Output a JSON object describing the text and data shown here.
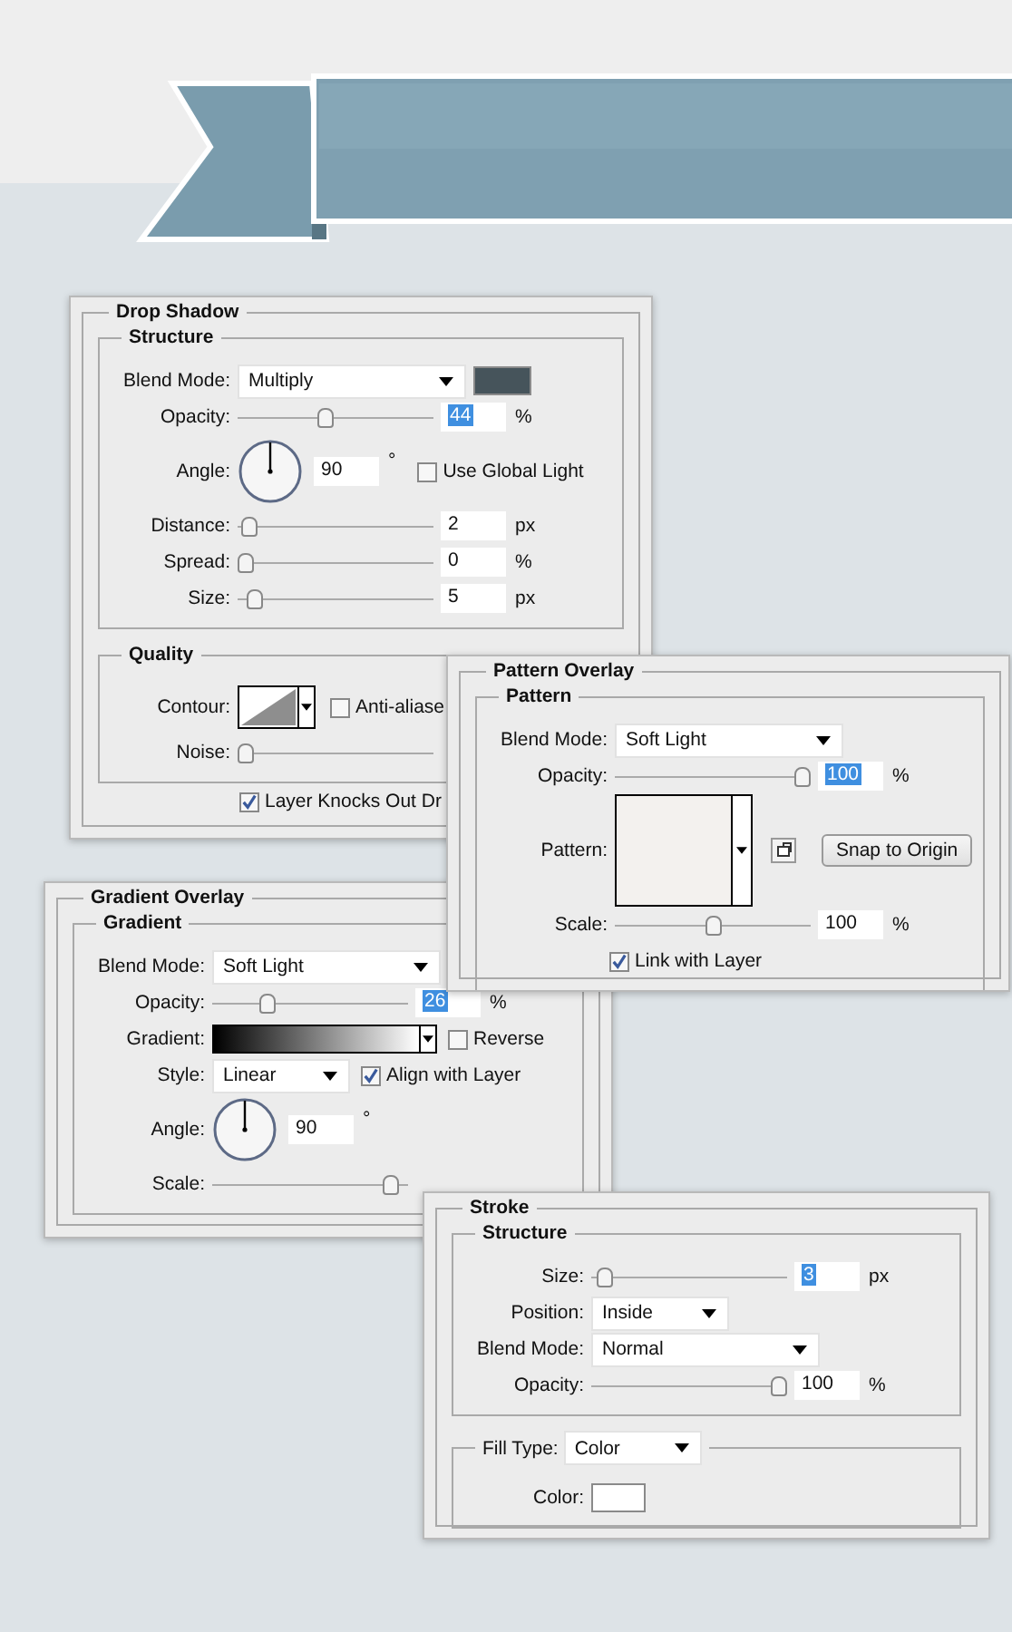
{
  "panels": [
    {
      "kind": "drop_shadow",
      "title": "Drop Shadow",
      "sections": [
        {
          "title": "Structure",
          "rows": [
            {
              "kind": "select",
              "label": "Blend Mode:",
              "value": "Multiply",
              "color": "#46545b"
            },
            {
              "kind": "slider",
              "label": "Opacity:",
              "level": 0.44,
              "value": "44",
              "unit": "%",
              "selected": true
            },
            {
              "kind": "angle",
              "label": "Angle:",
              "value": "90",
              "unit": "°",
              "checkbox": {
                "label": "Use Global Light",
                "checked": false
              }
            },
            {
              "kind": "slider",
              "label": "Distance:",
              "level": 0.02,
              "value": "2",
              "unit": "px",
              "selected": false
            },
            {
              "kind": "slider",
              "label": "Spread:",
              "level": 0,
              "value": "0",
              "unit": "%",
              "selected": false
            },
            {
              "kind": "slider",
              "label": "Size:",
              "level": 0.05,
              "value": "5",
              "unit": "px",
              "selected": false
            }
          ]
        },
        {
          "title": "Quality",
          "rows": [
            {
              "kind": "contour",
              "label": "Contour:",
              "checkbox": {
                "label": "Anti-aliase",
                "checked": false
              }
            },
            {
              "kind": "slider",
              "label": "Noise:",
              "level": 0
            }
          ]
        }
      ],
      "footer": {
        "label": "Layer Knocks Out Dr",
        "checked": true
      }
    },
    {
      "kind": "gradient_overlay",
      "title": "Gradient Overlay",
      "sections": [
        {
          "title": "Gradient",
          "rows": [
            {
              "kind": "select",
              "label": "Blend Mode:",
              "value": "Soft Light"
            },
            {
              "kind": "slider",
              "label": "Opacity:",
              "level": 0.26,
              "value": "26",
              "unit": "%",
              "selected": true
            },
            {
              "kind": "gradient",
              "label": "Gradient:",
              "checkbox": {
                "label": "Reverse",
                "checked": false
              }
            },
            {
              "kind": "short_select",
              "label": "Style:",
              "value": "Linear",
              "checkbox": {
                "label": "Align with Layer",
                "checked": true
              }
            },
            {
              "kind": "angle",
              "label": "Angle:",
              "value": "90",
              "unit": "°"
            },
            {
              "kind": "slider",
              "label": "Scale:",
              "level": 0.95
            }
          ]
        }
      ]
    },
    {
      "kind": "pattern_overlay",
      "title": "Pattern Overlay",
      "sections": [
        {
          "title": "Pattern",
          "rows": [
            {
              "kind": "select",
              "label": "Blend Mode:",
              "value": "Soft Light"
            },
            {
              "kind": "slider",
              "label": "Opacity:",
              "level": 1,
              "value": "100",
              "unit": "%",
              "selected": true
            },
            {
              "kind": "pattern",
              "label": "Pattern:",
              "button": "Snap to Origin"
            },
            {
              "kind": "slider",
              "label": "Scale:",
              "level": 0.5,
              "value": "100",
              "unit": "%",
              "selected": false
            },
            {
              "kind": "checkbox",
              "checkbox": {
                "label": "Link with Layer",
                "checked": true
              }
            }
          ]
        }
      ]
    },
    {
      "kind": "stroke",
      "title": "Stroke",
      "sections": [
        {
          "title": "Structure",
          "rows": [
            {
              "kind": "slider",
              "label": "Size:",
              "level": 0.03,
              "value": "3",
              "unit": "px",
              "selected": true
            },
            {
              "kind": "short_select",
              "label": "Position:",
              "value": "Inside"
            },
            {
              "kind": "select",
              "label": "Blend Mode:",
              "value": "Normal"
            },
            {
              "kind": "slider",
              "label": "Opacity:",
              "level": 1,
              "value": "100",
              "unit": "%",
              "selected": false
            }
          ]
        },
        {
          "title": "Fill Type:",
          "title_value": "Color",
          "rows": [
            {
              "kind": "color",
              "label": "Color:",
              "color": "#ffffff"
            }
          ]
        }
      ]
    }
  ]
}
